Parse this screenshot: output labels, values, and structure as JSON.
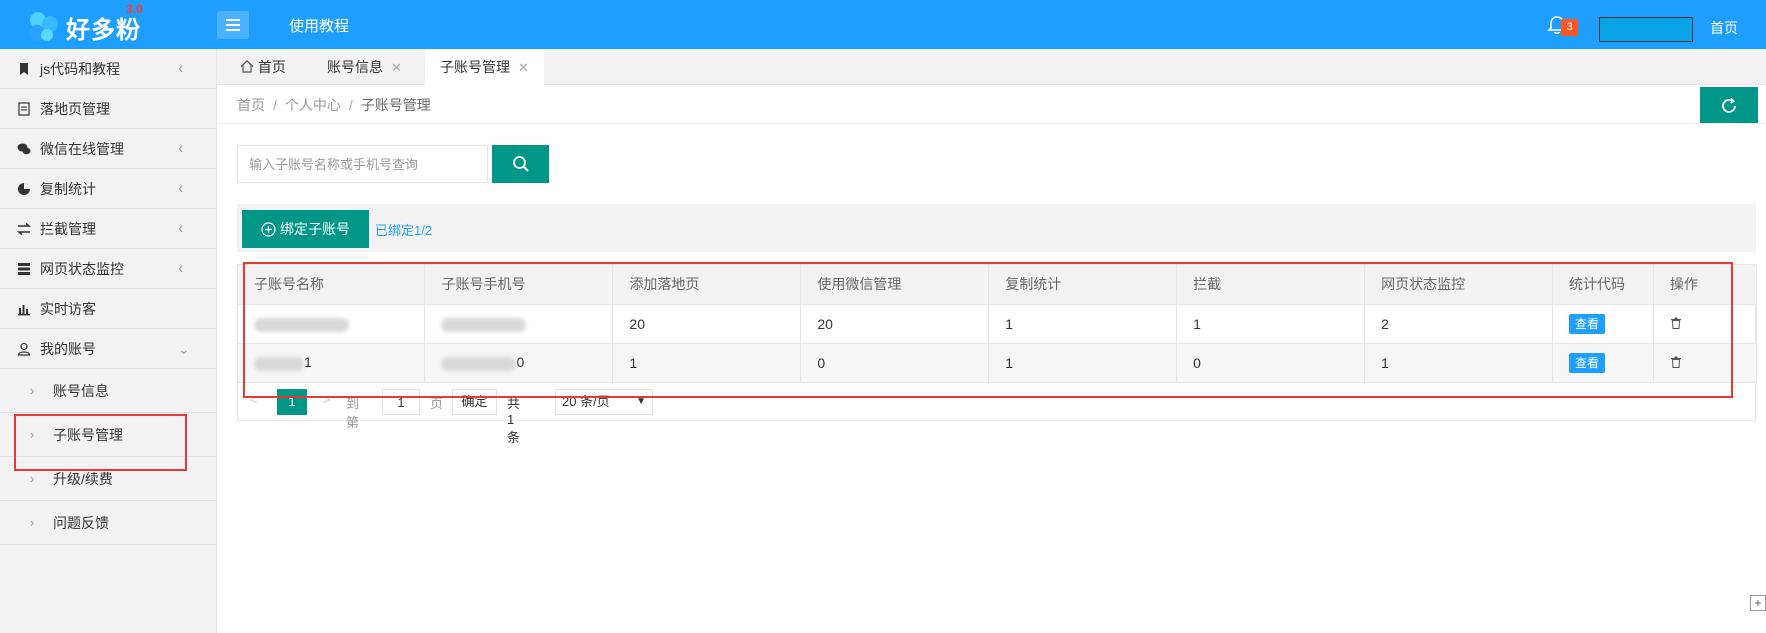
{
  "header": {
    "logo_text": "好多粉",
    "logo_version": "3.0",
    "tutorial_link": "使用教程",
    "notification_count": "3",
    "home_link": "首页"
  },
  "sidebar": {
    "items": [
      {
        "label": "js代码和教程",
        "icon": "bookmark-icon",
        "expandable": true
      },
      {
        "label": "落地页管理",
        "icon": "document-icon",
        "expandable": false
      },
      {
        "label": "微信在线管理",
        "icon": "wechat-icon",
        "expandable": true
      },
      {
        "label": "复制统计",
        "icon": "pie-chart-icon",
        "expandable": true
      },
      {
        "label": "拦截管理",
        "icon": "swap-icon",
        "expandable": true
      },
      {
        "label": "网页状态监控",
        "icon": "server-icon",
        "expandable": true
      },
      {
        "label": "实时访客",
        "icon": "bar-chart-icon",
        "expandable": false
      },
      {
        "label": "我的账号",
        "icon": "user-icon",
        "expandable": true
      }
    ],
    "sub_items": [
      {
        "label": "账号信息"
      },
      {
        "label": "子账号管理"
      },
      {
        "label": "升级/续费"
      },
      {
        "label": "问题反馈"
      }
    ]
  },
  "tabs": [
    {
      "label": "首页",
      "closable": false
    },
    {
      "label": "账号信息",
      "closable": true
    },
    {
      "label": "子账号管理",
      "closable": true,
      "active": true
    }
  ],
  "breadcrumb": {
    "home": "首页",
    "parent": "个人中心",
    "current": "子账号管理"
  },
  "search": {
    "placeholder": "输入子账号名称或手机号查询"
  },
  "toolbar": {
    "bind_button": "绑定子账号",
    "bind_count": "已绑定1/2"
  },
  "table": {
    "headers": [
      "子账号名称",
      "子账号手机号",
      "添加落地页",
      "使用微信管理",
      "复制统计",
      "拦截",
      "网页状态监控",
      "统计代码",
      "操作"
    ],
    "rows": [
      {
        "name_suffix": "",
        "phone_suffix": "",
        "landing": "20",
        "wechat": "20",
        "copy_stats": "1",
        "intercept": "1",
        "monitor": "2",
        "view_label": "查看"
      },
      {
        "name_suffix": "1",
        "phone_suffix": "0",
        "landing": "1",
        "wechat": "0",
        "copy_stats": "1",
        "intercept": "0",
        "monitor": "1",
        "view_label": "查看"
      }
    ]
  },
  "pager": {
    "prev": "<",
    "current_page": "1",
    "next": ">",
    "goto_label": "到第",
    "input_value": "1",
    "page_unit": "页",
    "confirm": "确定",
    "total": "共 1 条",
    "page_size": "20 条/页"
  },
  "colors": {
    "header": "#1e9fff",
    "primary_green": "#009688",
    "highlight_red": "#e53935"
  }
}
